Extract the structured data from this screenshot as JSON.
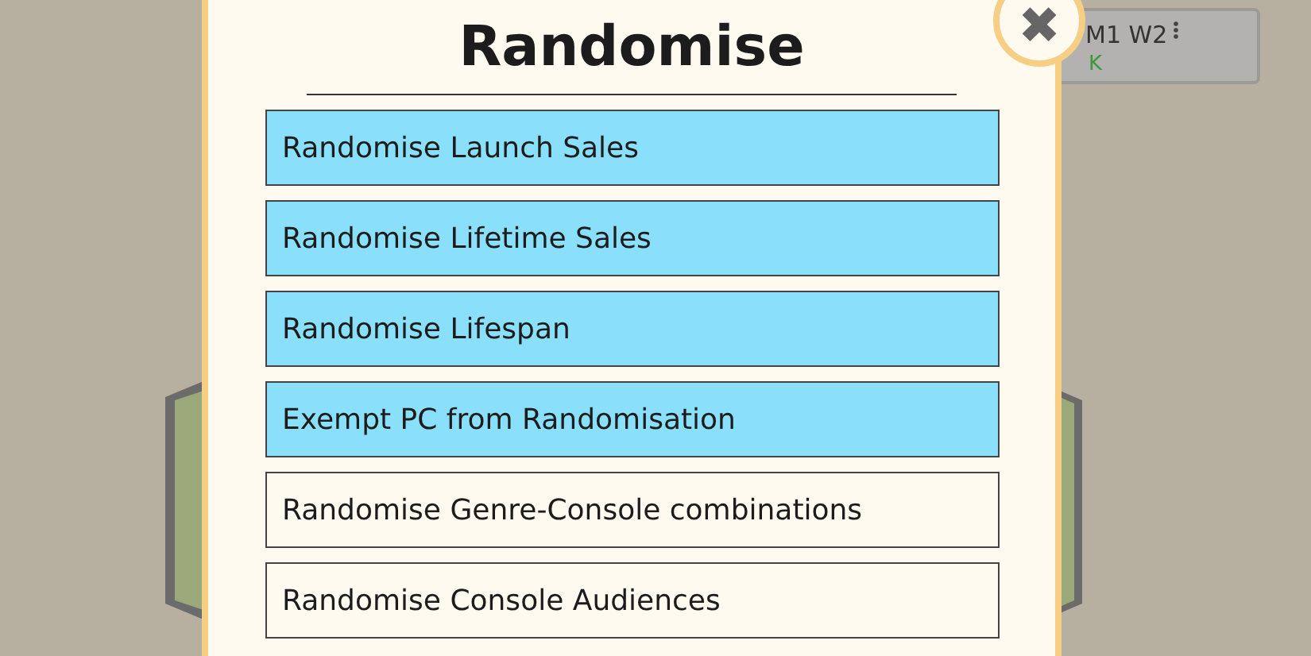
{
  "date_widget": {
    "date": "M1 W2",
    "status": "K"
  },
  "dialog": {
    "title": "Randomise",
    "close": "✖",
    "options": [
      {
        "label": "Randomise Launch Sales",
        "selected": true
      },
      {
        "label": "Randomise Lifetime Sales",
        "selected": true
      },
      {
        "label": "Randomise Lifespan",
        "selected": true
      },
      {
        "label": "Exempt PC from Randomisation",
        "selected": true
      },
      {
        "label": "Randomise Genre-Console combinations",
        "selected": false
      },
      {
        "label": "Randomise Console Audiences",
        "selected": false
      }
    ]
  }
}
